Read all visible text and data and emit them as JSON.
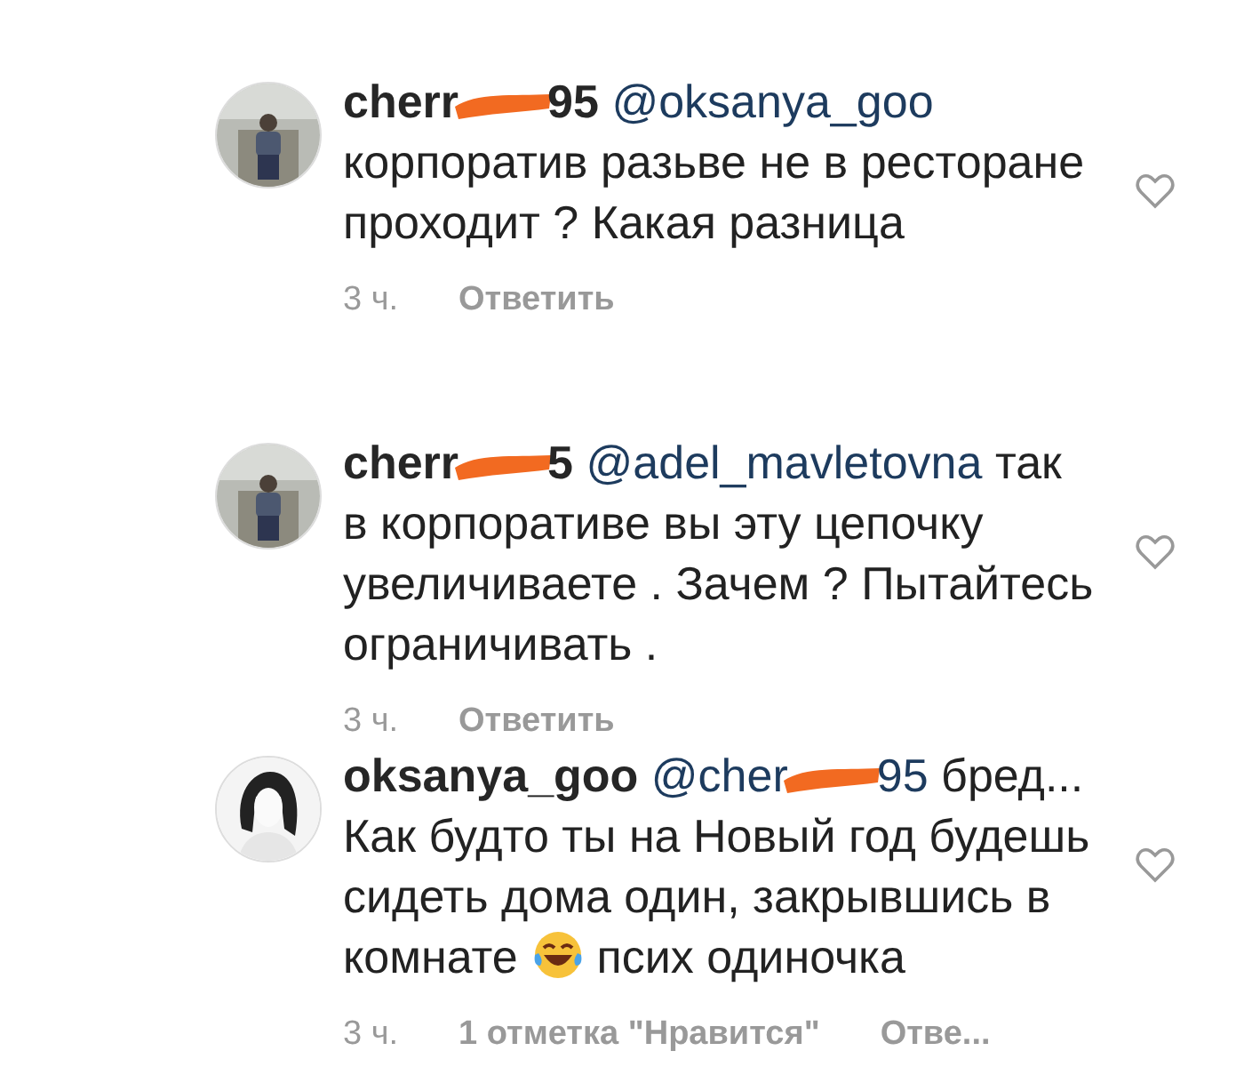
{
  "comments": [
    {
      "avatar": {
        "kind": "picture"
      },
      "author": [
        "cherr",
        "95"
      ],
      "mention": [
        "@oksanya_goo"
      ],
      "body": [
        {
          "kind": "block",
          "text": "корпоратив разьве не в ресторане проходит ? Какая разница"
        }
      ],
      "time": "3 ч.",
      "reply": "Ответить",
      "liked": false
    },
    {
      "avatar": {
        "kind": "picture"
      },
      "author": [
        "cherr",
        "5"
      ],
      "mention": [
        "@adel_mavletovna"
      ],
      "body": [
        {
          "kind": "tail",
          "text": "так"
        },
        {
          "kind": "block",
          "text": "в корпоративе вы эту цепочку увеличиваете . Зачем ? Пытайтесь ограничивать ."
        }
      ],
      "time": "3 ч.",
      "reply": "Ответить",
      "liked": false
    },
    {
      "avatar": {
        "kind": "picture"
      },
      "author": [
        "oksanya_goo"
      ],
      "mention": [
        "@cher",
        "95"
      ],
      "body": [
        {
          "kind": "tail",
          "text": "бред..."
        },
        {
          "kind": "block",
          "text": "Как будто ты на Новый год будешь сидеть дома один, закрывшись в"
        },
        {
          "kind": "inline",
          "text": "комнате"
        },
        {
          "kind": "emoji"
        },
        {
          "kind": "inline",
          "text": "псих одиночка"
        }
      ],
      "time": "3 ч.",
      "likes": "1 отметка \"Нравится\"",
      "reply": "Отве...",
      "liked": false
    }
  ]
}
